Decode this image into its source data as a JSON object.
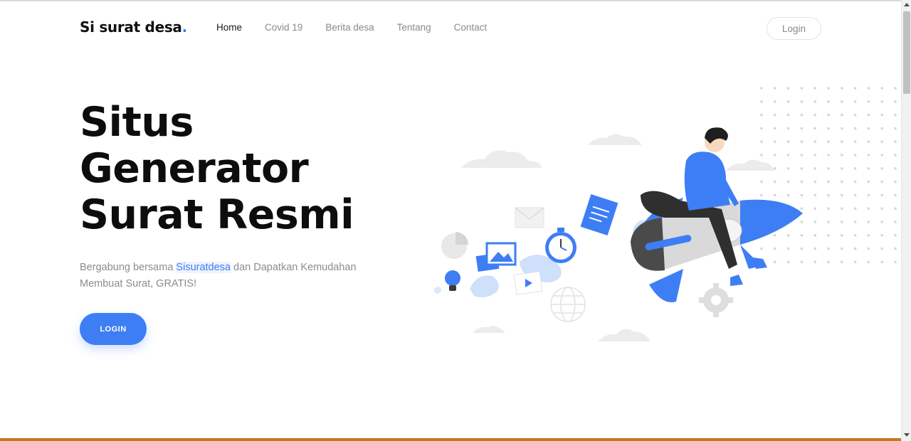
{
  "header": {
    "brand": "Si surat desa",
    "brand_dot": ".",
    "nav": [
      {
        "label": "Home"
      },
      {
        "label": "Covid 19"
      },
      {
        "label": "Berita desa"
      },
      {
        "label": "Tentang"
      },
      {
        "label": "Contact"
      }
    ],
    "login_label": "Login"
  },
  "hero": {
    "title_lines": [
      "Situs",
      "Generator",
      "Surat Resmi"
    ],
    "subtitle_before": "Bergabung bersama ",
    "subtitle_highlight": "Sisuratdesa",
    "subtitle_after": " dan Dapatkan Kemudahan Membuat Surat, GRATIS!",
    "cta_label": "LOGIN"
  },
  "colors": {
    "accent": "#3e7ef5",
    "title": "#0d0d0d",
    "muted": "#8c8c8c"
  },
  "illustration": {
    "icons": [
      "rocket-icon",
      "person-icon",
      "stopwatch-icon",
      "document-icon",
      "image-icon",
      "envelope-icon",
      "lightbulb-icon",
      "globe-icon",
      "gear-icon",
      "play-icon",
      "pie-chart-icon"
    ]
  }
}
